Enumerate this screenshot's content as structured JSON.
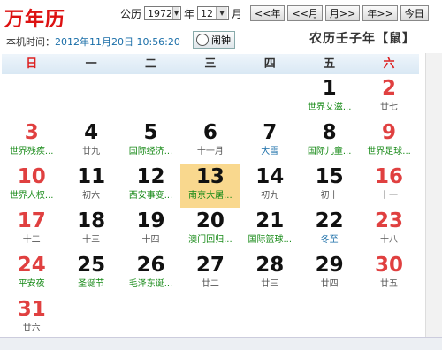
{
  "app": {
    "title": "万年历"
  },
  "toolbar": {
    "gongli_label": "公历",
    "year_value": "1972",
    "year_unit": "年",
    "month_value": "12",
    "month_unit": "月",
    "prev_year": "<<年",
    "prev_month": "<<月",
    "next_month": "月>>",
    "next_year": "年>>",
    "today": "今日"
  },
  "local_time": {
    "label": "本机时间：",
    "value": "2012年11月20日 10:56:20"
  },
  "clock_button": "闹钟",
  "lunar_year": "农历壬子年【鼠】",
  "weekdays": [
    "日",
    "一",
    "二",
    "三",
    "四",
    "五",
    "六"
  ],
  "days": [
    {
      "num": "",
      "sub": ""
    },
    {
      "num": "",
      "sub": ""
    },
    {
      "num": "",
      "sub": ""
    },
    {
      "num": "",
      "sub": ""
    },
    {
      "num": "",
      "sub": ""
    },
    {
      "num": "1",
      "sub": "世界艾滋..."
    },
    {
      "num": "2",
      "sub": "廿七"
    },
    {
      "num": "3",
      "sub": "世界残疾..."
    },
    {
      "num": "4",
      "sub": "廿九"
    },
    {
      "num": "5",
      "sub": "国际经济..."
    },
    {
      "num": "6",
      "sub": "十一月"
    },
    {
      "num": "7",
      "sub": "大雪"
    },
    {
      "num": "8",
      "sub": "国际儿童..."
    },
    {
      "num": "9",
      "sub": "世界足球..."
    },
    {
      "num": "10",
      "sub": "世界人权..."
    },
    {
      "num": "11",
      "sub": "初六"
    },
    {
      "num": "12",
      "sub": "西安事变..."
    },
    {
      "num": "13",
      "sub": "南京大屠..."
    },
    {
      "num": "14",
      "sub": "初九"
    },
    {
      "num": "15",
      "sub": "初十"
    },
    {
      "num": "16",
      "sub": "十一"
    },
    {
      "num": "17",
      "sub": "十二"
    },
    {
      "num": "18",
      "sub": "十三"
    },
    {
      "num": "19",
      "sub": "十四"
    },
    {
      "num": "20",
      "sub": "澳门回归..."
    },
    {
      "num": "21",
      "sub": "国际篮球..."
    },
    {
      "num": "22",
      "sub": "冬至"
    },
    {
      "num": "23",
      "sub": "十八"
    },
    {
      "num": "24",
      "sub": "平安夜"
    },
    {
      "num": "25",
      "sub": "圣诞节"
    },
    {
      "num": "26",
      "sub": "毛泽东诞..."
    },
    {
      "num": "27",
      "sub": "廿二"
    },
    {
      "num": "28",
      "sub": "廿三"
    },
    {
      "num": "29",
      "sub": "廿四"
    },
    {
      "num": "30",
      "sub": "廿五"
    },
    {
      "num": "31",
      "sub": "廿六"
    },
    {
      "num": "",
      "sub": ""
    },
    {
      "num": "",
      "sub": ""
    },
    {
      "num": "",
      "sub": ""
    },
    {
      "num": "",
      "sub": ""
    },
    {
      "num": "",
      "sub": ""
    },
    {
      "num": "",
      "sub": ""
    }
  ],
  "highlight_day": "13",
  "festival_days": [
    "1",
    "3",
    "5",
    "8",
    "9",
    "10",
    "12",
    "13",
    "20",
    "21",
    "24",
    "25",
    "26"
  ],
  "solar_term_days": [
    "7",
    "22"
  ],
  "colors": {
    "weekend": "#e04040",
    "festival": "#178a17",
    "solar_term": "#1a6ea8",
    "today_bg": "#f9d88e",
    "title": "#dd1111"
  }
}
